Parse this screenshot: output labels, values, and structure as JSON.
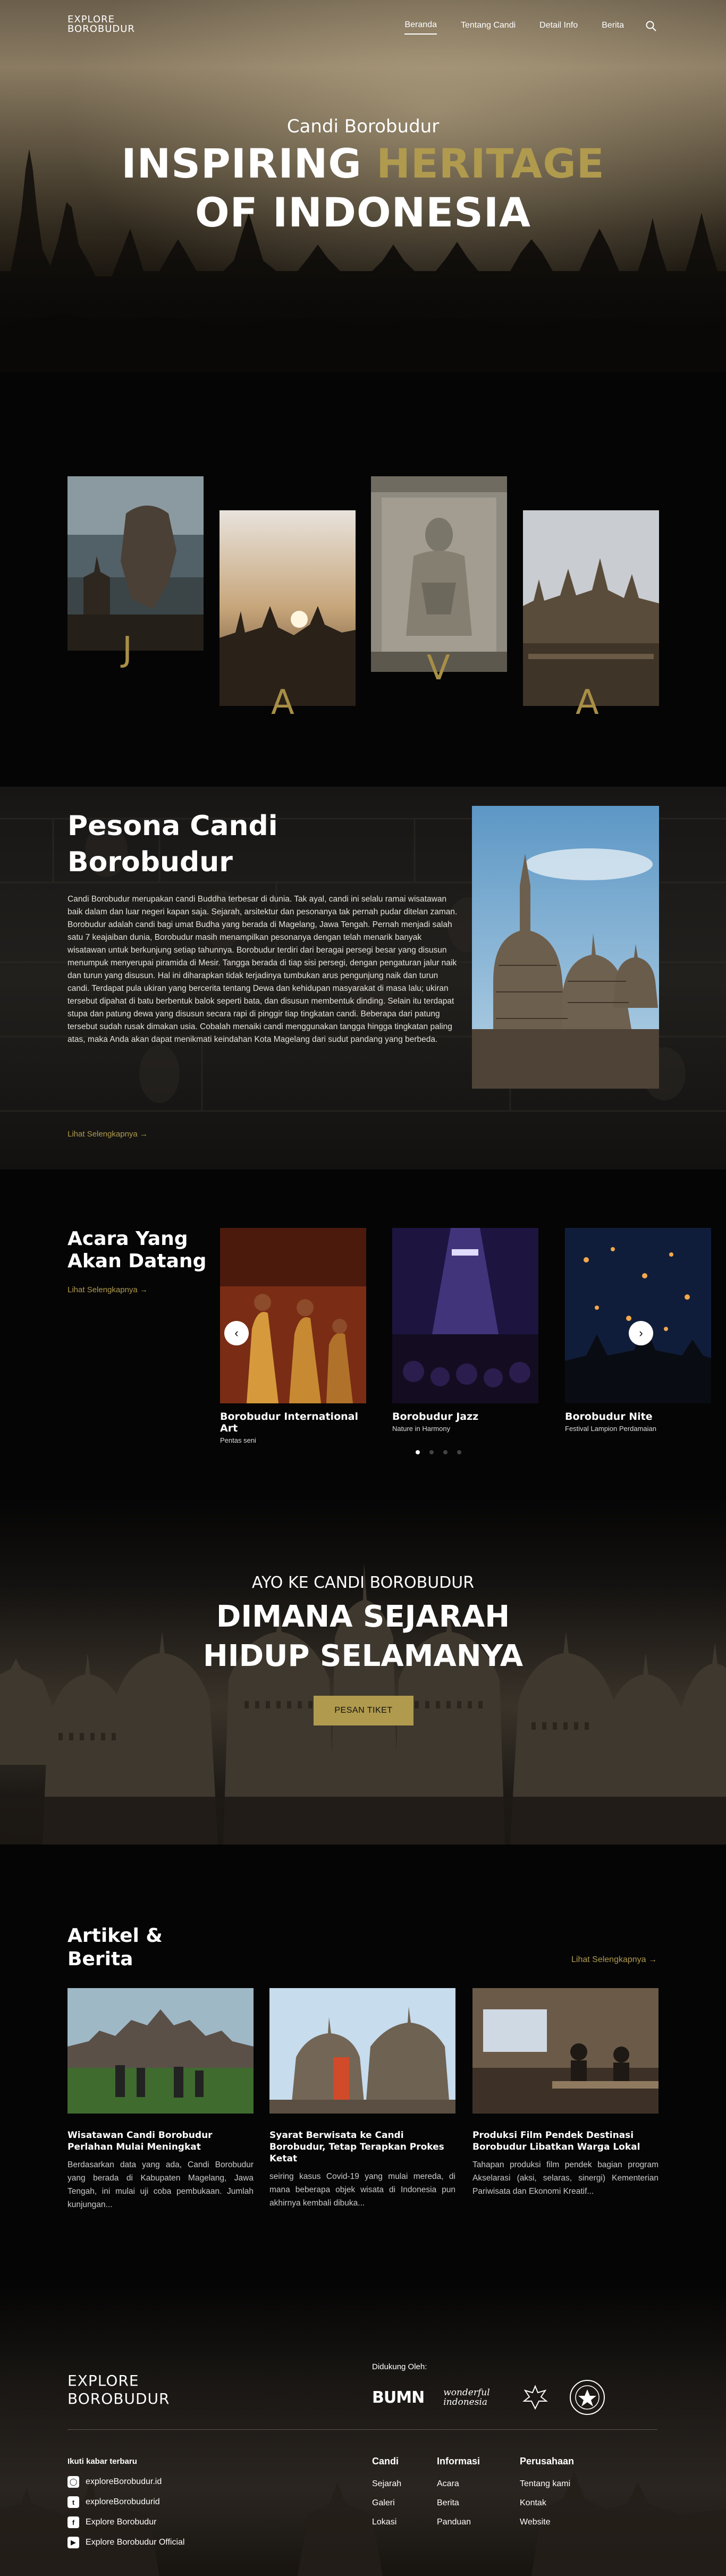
{
  "nav": {
    "logo_line1": "EXPLORE",
    "logo_line2": "BOROBUDUR",
    "links": [
      "Beranda",
      "Tentang Candi",
      "Detail Info",
      "Berita"
    ],
    "active": "Beranda"
  },
  "hero": {
    "subtitle": "Candi Borobudur",
    "title_1": "INSPIRING",
    "title_highlight": "HERITAGE",
    "title_2": "OF INDONESIA"
  },
  "java": {
    "letters": [
      "J",
      "A",
      "V",
      "A"
    ]
  },
  "pesona": {
    "title": "Pesona Candi Borobudur",
    "body": "Candi Borobudur merupakan candi Buddha terbesar di dunia. Tak ayal, candi ini selalu ramai wisatawan baik dalam dan luar negeri kapan saja. Sejarah, arsitektur dan pesonanya tak pernah pudar ditelan zaman. Borobudur adalah candi bagi umat Budha yang berada di Magelang, Jawa Tengah. Pernah menjadi salah satu 7 keajaiban dunia, Borobudur masih menampilkan pesonanya dengan telah menarik banyak wisatawan untuk berkunjung setiap tahunnya. Borobudur terdiri dari beragai persegi besar yang disusun menumpuk menyerupai piramida di Mesir. Tangga berada di tiap sisi persegi, dengan pengaturan jalur naik dan turun yang disusun. Hal ini diharapkan tidak terjadinya tumbukan arus pengunjung naik dan turun candi. Terdapat pula ukiran yang bercerita tentang Dewa dan kehidupan masyarakat di masa lalu; ukiran tersebut dipahat di batu berbentuk balok seperti bata, dan disusun membentuk dinding. Selain itu terdapat stupa dan patung dewa yang disusun secara rapi di pinggir tiap tingkatan candi. Beberapa dari patung tersebut sudah rusak dimakan usia. Cobalah menaiki candi menggunakan tangga hingga tingkatan paling atas, maka Anda akan dapat menikmati keindahan Kota Magelang dari sudut pandang yang berbeda.",
    "link": "Lihat Selengkapnya →"
  },
  "events": {
    "title": "Acara Yang Akan Datang",
    "link": "Lihat Selengkapnya →",
    "items": [
      {
        "name": "Borobudur International Art",
        "category": "Pentas seni"
      },
      {
        "name": "Borobudur Jazz",
        "category": "Nature in Harmony"
      },
      {
        "name": "Borobudur Nite",
        "category": "Festival Lampion Perdamaian"
      }
    ]
  },
  "cta": {
    "subtitle": "AYO KE CANDI BOROBUDUR",
    "title_1": "DIMANA SEJARAH",
    "title_2": "HIDUP SELAMANYA",
    "button": "PESAN TIKET"
  },
  "articles": {
    "title": "Artikel & Berita",
    "link": "Lihat Selengkapnya →",
    "items": [
      {
        "title": "Wisatawan Candi Borobudur Perlahan Mulai Meningkat",
        "excerpt": "Berdasarkan data yang ada, Candi Borobudur yang berada di Kabupaten Magelang, Jawa Tengah, ini mulai uji coba pembukaan. Jumlah kunjungan..."
      },
      {
        "title": "Syarat Berwisata ke Candi Borobudur, Tetap Terapkan Prokes Ketat",
        "excerpt": "seiring kasus Covid-19 yang mulai mereda, di mana beberapa objek wisata di Indonesia pun akhirnya kembali dibuka..."
      },
      {
        "title": "Produksi Film Pendek Destinasi Borobudur Libatkan Warga Lokal",
        "excerpt": "Tahapan produksi film pendek bagian program Akselarasi (aksi, selaras, sinergi) Kementerian Pariwisata dan Ekonomi Kreatif..."
      }
    ]
  },
  "footer": {
    "logo_line1": "EXPLORE",
    "logo_line2": "BOROBUDUR",
    "supported_by": "Didukung Oleh:",
    "sponsors": [
      "BUMN",
      "wonderful indonesia"
    ],
    "social_heading": "Ikuti kabar terbaru",
    "social": [
      "exploreBorobudur.id",
      "exploreBorobudurid",
      "Explore Borobudur",
      "Explore Borobudur Official"
    ],
    "columns": [
      {
        "heading": "Candi",
        "links": [
          "Sejarah",
          "Galeri",
          "Lokasi"
        ]
      },
      {
        "heading": "Informasi",
        "links": [
          "Acara",
          "Berita",
          "Panduan"
        ]
      },
      {
        "heading": "Perusahaan",
        "links": [
          "Tentang kami",
          "Kontak",
          "Website"
        ]
      }
    ]
  },
  "colors": {
    "accent_gold": "#b09a4e",
    "background": "#050505"
  },
  "icons": [
    "search-icon",
    "chevron-left-icon",
    "chevron-right-icon",
    "instagram-icon",
    "twitter-icon",
    "facebook-icon",
    "youtube-icon"
  ]
}
